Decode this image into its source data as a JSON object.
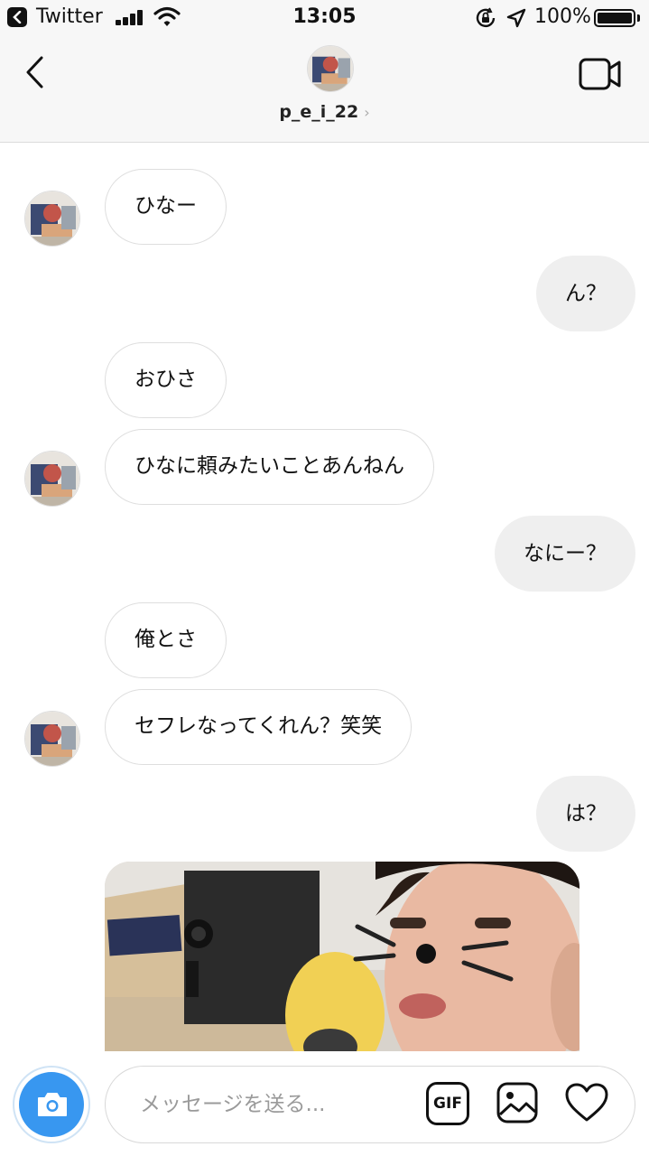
{
  "status_bar": {
    "back_app": "Twitter",
    "time": "13:05",
    "battery_percent_label": "100%",
    "battery_level": 1.0,
    "icons": [
      "back-arrow-icon",
      "signal-icon",
      "wifi-icon",
      "rotation-lock-icon",
      "location-icon",
      "battery-icon"
    ]
  },
  "header": {
    "username": "p_e_i_22",
    "chevron": "›",
    "icons": [
      "back-chevron-icon",
      "video-call-icon"
    ]
  },
  "messages": [
    {
      "dir": "in",
      "text": "ひなー",
      "avatar": true
    },
    {
      "dir": "out",
      "text": "ん？"
    },
    {
      "dir": "in",
      "text": "おひさ",
      "avatar": false
    },
    {
      "dir": "in",
      "text": "ひなに頼みたいことあんねん",
      "avatar": true
    },
    {
      "dir": "out",
      "text": "なにー？"
    },
    {
      "dir": "in",
      "text": "俺とさ",
      "avatar": false
    },
    {
      "dir": "in",
      "text": "セフレなってくれん？笑笑",
      "avatar": true
    },
    {
      "dir": "out",
      "text": "は？"
    },
    {
      "dir": "in",
      "type": "photo",
      "description_icon": "photo-message"
    }
  ],
  "composer": {
    "placeholder": "メッセージを送る...",
    "gif_label": "GIF",
    "icons": [
      "camera-icon",
      "gallery-icon",
      "heart-icon"
    ]
  },
  "colors": {
    "accent_blue": "#3897f0",
    "outgoing_bubble": "#efefef",
    "bar_background": "#f7f7f7"
  }
}
